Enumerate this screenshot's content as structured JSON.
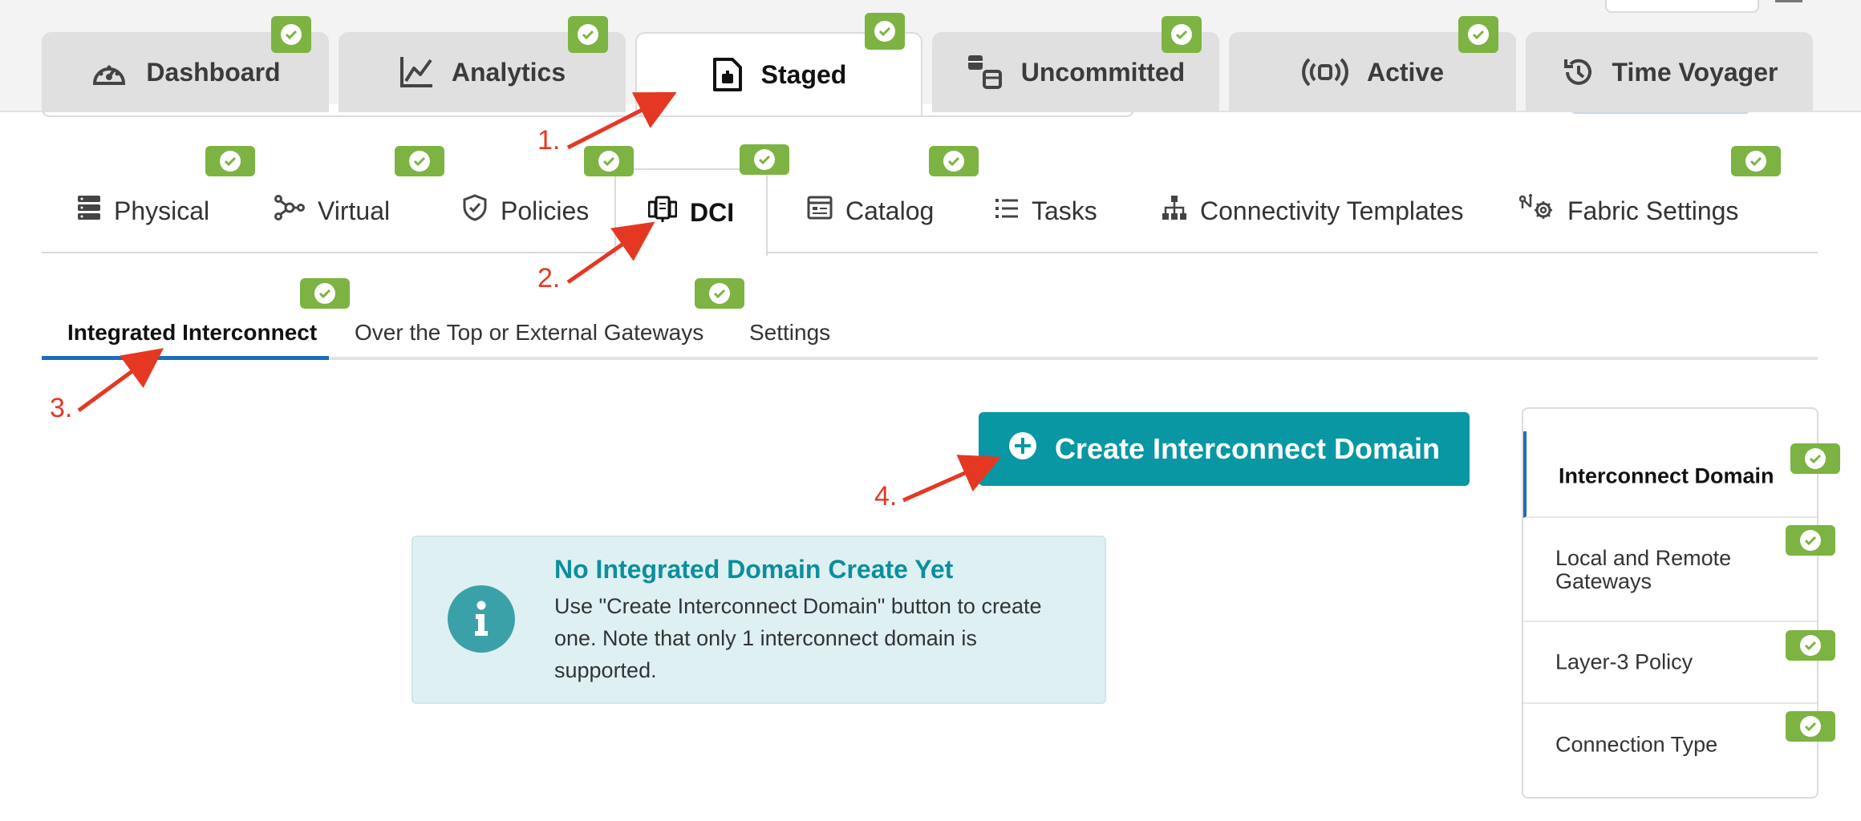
{
  "main_tabs": [
    {
      "label": "Dashboard",
      "icon": "gauge-icon"
    },
    {
      "label": "Analytics",
      "icon": "line-chart-icon"
    },
    {
      "label": "Staged",
      "icon": "staged-document-icon",
      "active": true
    },
    {
      "label": "Uncommitted",
      "icon": "uncommitted-boxes-icon"
    },
    {
      "label": "Active",
      "icon": "broadcast-icon"
    },
    {
      "label": "Time Voyager",
      "icon": "history-icon"
    }
  ],
  "sub_tabs": [
    {
      "label": "Physical",
      "icon": "server-stack-icon"
    },
    {
      "label": "Virtual",
      "icon": "network-nodes-icon"
    },
    {
      "label": "Policies",
      "icon": "shield-check-icon"
    },
    {
      "label": "DCI",
      "icon": "dci-icon",
      "active": true
    },
    {
      "label": "Catalog",
      "icon": "catalog-window-icon"
    },
    {
      "label": "Tasks",
      "icon": "task-list-icon"
    },
    {
      "label": "Connectivity Templates",
      "icon": "hierarchy-icon"
    },
    {
      "label": "Fabric Settings",
      "icon": "fabric-settings-icon"
    }
  ],
  "third_tabs": [
    {
      "label": "Integrated Interconnect",
      "active": true
    },
    {
      "label": "Over the Top or External Gateways"
    },
    {
      "label": "Settings"
    }
  ],
  "create_button": {
    "label": "Create Interconnect Domain",
    "icon": "plus-circle-icon"
  },
  "info": {
    "icon": "info-circle-icon",
    "title": "No Integrated Domain Create Yet",
    "body": "Use \"Create Interconnect Domain\" button to create one. Note that only 1 interconnect domain is supported."
  },
  "side_panel": [
    {
      "label": "Interconnect Domain",
      "active": true
    },
    {
      "label": "Local and Remote Gateways"
    },
    {
      "label": "Layer-3 Policy"
    },
    {
      "label": "Connection Type"
    }
  ],
  "annotations": [
    "1.",
    "2.",
    "3.",
    "4."
  ],
  "colors": {
    "accent_teal": "#0a97a4",
    "check_green": "#7cb342",
    "annotation_red": "#e53823",
    "active_blue": "#1e6db8",
    "info_bg": "#dff0f2"
  }
}
